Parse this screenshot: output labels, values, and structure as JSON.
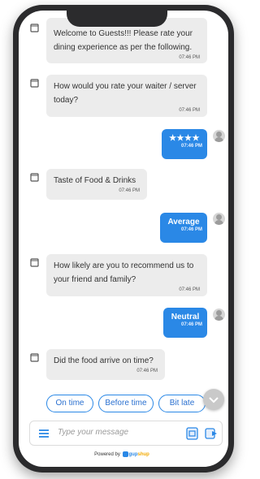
{
  "messages": [
    {
      "from": "bot",
      "text_lines": [
        "Welcome to Guests!!! Please rate your",
        "dining experience as per the following."
      ],
      "time": "07:46 PM"
    },
    {
      "from": "bot",
      "text_lines": [
        "How would you rate your waiter / server",
        "today?"
      ],
      "time": "07:46 PM"
    },
    {
      "from": "user",
      "text": "★★★★",
      "time": "07:46 PM"
    },
    {
      "from": "bot",
      "text_lines": [
        "Taste of Food & Drinks"
      ],
      "time": "07:46 PM"
    },
    {
      "from": "user",
      "text": "Average",
      "time": "07:46 PM"
    },
    {
      "from": "bot",
      "text_lines": [
        "How likely are you to recommend us to",
        "your friend and family?"
      ],
      "time": "07:46 PM"
    },
    {
      "from": "user",
      "text": "Neutral",
      "time": "07:46 PM"
    },
    {
      "from": "bot",
      "text_lines": [
        "Did the food arrive on time?"
      ],
      "time": "07:46 PM"
    }
  ],
  "quick_replies": [
    "On time",
    "Before time",
    "Bit late"
  ],
  "input": {
    "placeholder": "Type your message"
  },
  "footer": {
    "prefix": "Powered by",
    "brand_part1": "gup",
    "brand_part2": "shup"
  },
  "colors": {
    "accent": "#2a88e6",
    "bot_bubble": "#ececec",
    "phone_frame": "#2b2b2d"
  },
  "icons": {
    "bot": "bot-icon",
    "user": "user-avatar-icon",
    "menu": "menu-icon",
    "attach": "attach-icon",
    "send": "send-icon",
    "scroll": "chevron-down-icon"
  }
}
